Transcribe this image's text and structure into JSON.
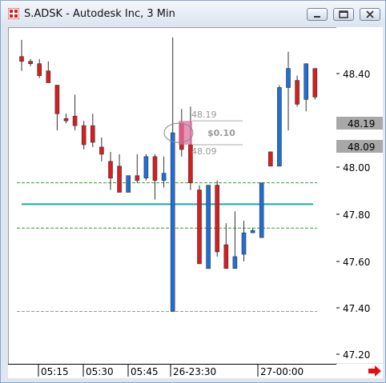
{
  "window": {
    "title": "S.ADSK - Autodesk Inc, 3 Min",
    "icons": {
      "app": "chart-app-icon",
      "minimize": "minimize-icon",
      "maximize": "maximize-icon",
      "close": "close-icon"
    }
  },
  "colors": {
    "up": "#1f6fd6",
    "down": "#d81e1e",
    "level_line": "#19a8b8",
    "green_line": "#2e9f2e",
    "marker": "#e070a0"
  },
  "price_axis": {
    "ticks": [
      "48.40",
      "48.00",
      "47.80",
      "47.60",
      "47.40",
      "47.20"
    ],
    "highlight_labels": [
      "48.19",
      "48.09"
    ]
  },
  "time_axis": {
    "labels": [
      "05:15",
      "05:30",
      "05:45",
      "26-23:30",
      "27-00:00"
    ]
  },
  "chart_data": {
    "type": "candlestick",
    "ylim": [
      47.17,
      48.58
    ],
    "series": [
      {
        "open": 48.46,
        "high": 48.53,
        "low": 48.4,
        "close": 48.44
      },
      {
        "open": 48.44,
        "high": 48.45,
        "low": 48.42,
        "close": 48.43
      },
      {
        "open": 48.43,
        "high": 48.45,
        "low": 48.37,
        "close": 48.38
      },
      {
        "open": 48.4,
        "high": 48.44,
        "low": 48.36,
        "close": 48.35
      },
      {
        "open": 48.34,
        "high": 48.34,
        "low": 48.15,
        "close": 48.22
      },
      {
        "open": 48.2,
        "high": 48.22,
        "low": 48.18,
        "close": 48.19
      },
      {
        "open": 48.21,
        "high": 48.3,
        "low": 48.15,
        "close": 48.17
      },
      {
        "open": 48.17,
        "high": 48.19,
        "low": 48.07,
        "close": 48.09
      },
      {
        "open": 48.17,
        "high": 48.22,
        "low": 48.08,
        "close": 48.1
      },
      {
        "open": 48.08,
        "high": 48.12,
        "low": 48.02,
        "close": 48.05
      },
      {
        "open": 48.02,
        "high": 48.06,
        "low": 47.9,
        "close": 47.95
      },
      {
        "open": 48.0,
        "high": 48.05,
        "low": 47.9,
        "close": 47.89
      },
      {
        "open": 47.89,
        "high": 47.95,
        "low": 47.89,
        "close": 47.96
      },
      {
        "open": 47.96,
        "high": 48.05,
        "low": 47.93,
        "close": 47.94
      },
      {
        "open": 47.95,
        "high": 48.05,
        "low": 47.94,
        "close": 48.04
      },
      {
        "open": 48.04,
        "high": 48.05,
        "low": 47.86,
        "close": 47.94
      },
      {
        "open": 47.94,
        "high": 48.04,
        "low": 47.91,
        "close": 47.97
      },
      {
        "open": 47.39,
        "high": 48.54,
        "low": 47.39,
        "close": 48.14
      },
      {
        "open": 48.18,
        "high": 48.24,
        "low": 48.04,
        "close": 48.07
      },
      {
        "open": 48.09,
        "high": 48.25,
        "low": 47.9,
        "close": 47.93
      },
      {
        "open": 47.9,
        "high": 47.92,
        "low": 47.59,
        "close": 47.59
      },
      {
        "open": 47.57,
        "high": 47.92,
        "low": 47.57,
        "close": 47.92
      },
      {
        "open": 47.92,
        "high": 47.94,
        "low": 47.62,
        "close": 47.64
      },
      {
        "open": 47.67,
        "high": 47.76,
        "low": 47.57,
        "close": 47.57
      },
      {
        "open": 47.57,
        "high": 47.81,
        "low": 47.57,
        "close": 47.62
      },
      {
        "open": 47.63,
        "high": 47.77,
        "low": 47.6,
        "close": 47.72
      },
      {
        "open": 47.72,
        "high": 47.74,
        "low": 47.72,
        "close": 47.73
      },
      {
        "open": 47.7,
        "high": 47.7,
        "low": 47.7,
        "close": 47.93
      },
      {
        "open": 48.06,
        "high": 48.06,
        "low": 48.0,
        "close": 48.0
      },
      {
        "open": 48.0,
        "high": 48.34,
        "low": 48.0,
        "close": 48.33
      },
      {
        "open": 48.33,
        "high": 48.48,
        "low": 48.15,
        "close": 48.41
      },
      {
        "open": 48.36,
        "high": 48.38,
        "low": 48.25,
        "close": 48.26
      },
      {
        "open": 48.28,
        "high": 48.4,
        "low": 48.23,
        "close": 48.43
      },
      {
        "open": 48.41,
        "high": 48.41,
        "low": 48.28,
        "close": 48.29
      }
    ],
    "horizontal_lines": [
      {
        "name": "green-upper",
        "value": 47.93,
        "style": "dashed",
        "color": "#2e9f2e"
      },
      {
        "name": "cyan-level",
        "value": 47.84,
        "style": "solid",
        "color": "#19a8b8"
      },
      {
        "name": "green-lower",
        "value": 47.74,
        "style": "dashed",
        "color": "#2e9f2e"
      },
      {
        "name": "gray-low",
        "value": 47.39,
        "style": "dashed",
        "color": "#999999"
      }
    ],
    "annotation": {
      "upper": "48.19",
      "lower": "48.09",
      "spread": "$0.10"
    }
  }
}
